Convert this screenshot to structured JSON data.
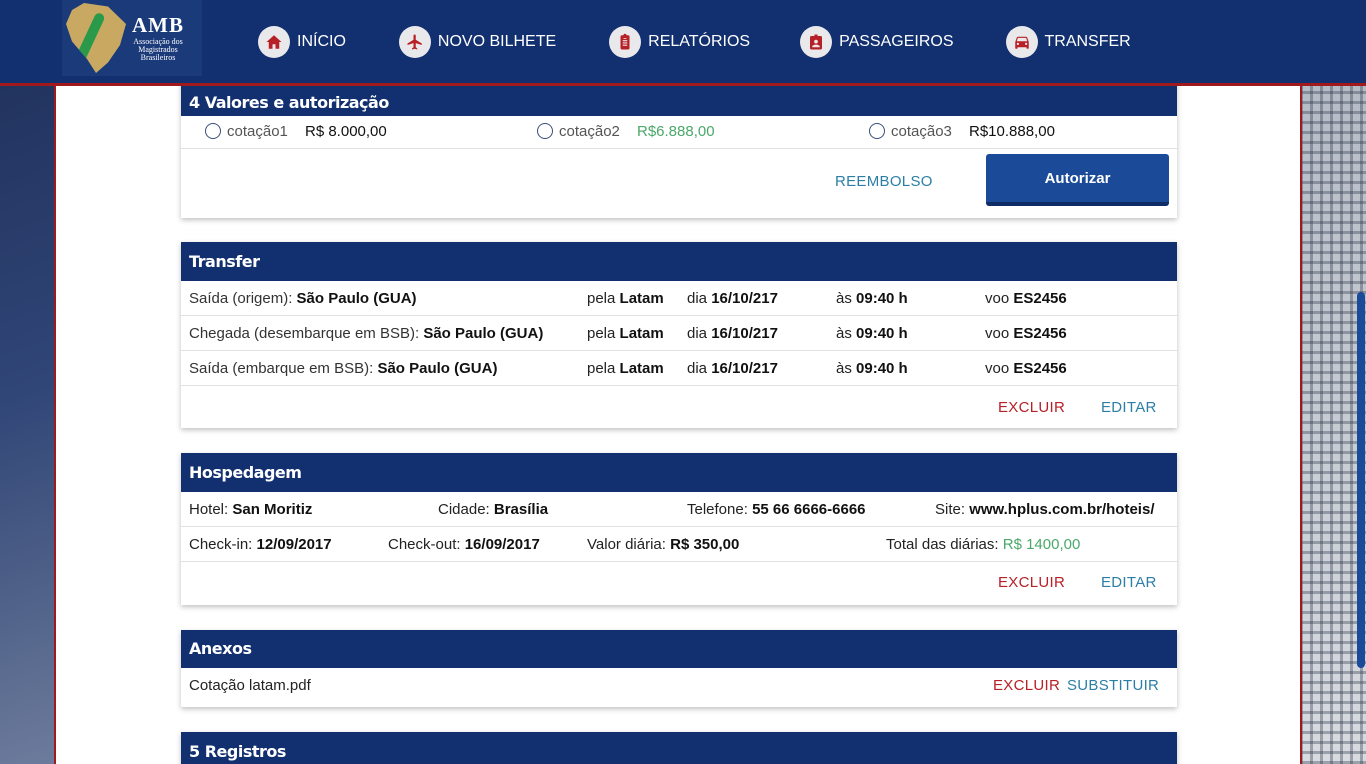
{
  "header": {
    "logo_title": "AMB",
    "logo_sub1": "Associação dos",
    "logo_sub2": "Magistrados",
    "logo_sub3": "Brasileiros",
    "nav": [
      {
        "label": "INÍCIO",
        "icon": "home-icon"
      },
      {
        "label": "NOVO BILHETE",
        "icon": "airplane-icon"
      },
      {
        "label": "RELATÓRIOS",
        "icon": "clipboard-icon"
      },
      {
        "label": "PASSAGEIROS",
        "icon": "badge-icon"
      },
      {
        "label": "TRANSFER",
        "icon": "car-icon"
      }
    ]
  },
  "valores": {
    "title": "4 Valores e autorização",
    "options": [
      {
        "label": "cotação1",
        "value": "R$ 8.000,00"
      },
      {
        "label": "cotação2",
        "value": "R$6.888,00"
      },
      {
        "label": "cotação3",
        "value": "R$10.888,00"
      }
    ],
    "reembolso": "REEMBOLSO",
    "autorizar": "Autorizar"
  },
  "transfer": {
    "title": "Transfer",
    "rows": [
      {
        "label": "Saída (origem):",
        "place": "São Paulo (GUA)",
        "pela": "pela",
        "company": "Latam",
        "dia": "dia",
        "date": "16/10/217",
        "as": "às",
        "time": "09:40 h",
        "voo": "voo",
        "flight": "ES2456"
      },
      {
        "label": "Chegada (desembarque em BSB):",
        "place": "São Paulo (GUA)",
        "pela": "pela",
        "company": "Latam",
        "dia": "dia",
        "date": "16/10/217",
        "as": "às",
        "time": "09:40 h",
        "voo": "voo",
        "flight": "ES2456"
      },
      {
        "label": "Saída (embarque em BSB):",
        "place": "São Paulo (GUA)",
        "pela": "pela",
        "company": "Latam",
        "dia": "dia",
        "date": "16/10/217",
        "as": "às",
        "time": "09:40 h",
        "voo": "voo",
        "flight": "ES2456"
      }
    ],
    "excluir": "EXCLUIR",
    "editar": "EDITAR"
  },
  "hospedagem": {
    "title": "Hospedagem",
    "hotel_label": "Hotel:",
    "hotel": "San Moritiz",
    "cidade_label": "Cidade:",
    "cidade": "Brasília",
    "telefone_label": "Telefone:",
    "telefone": "55 66 6666-6666",
    "site_label": "Site:",
    "site": "www.hplus.com.br/hoteis/",
    "checkin_label": "Check-in:",
    "checkin": "12/09/2017",
    "checkout_label": "Check-out:",
    "checkout": "16/09/2017",
    "diaria_label": "Valor diária:",
    "diaria": "R$ 350,00",
    "total_label": "Total das diárias:",
    "total": "R$ 1400,00",
    "excluir": "EXCLUIR",
    "editar": "EDITAR"
  },
  "anexos": {
    "title": "Anexos",
    "file": "Cotação latam.pdf",
    "excluir": "EXCLUIR",
    "substituir": "SUBSTITUIR"
  },
  "registros": {
    "title": "5 Registros"
  },
  "colors": {
    "header": "#12306f",
    "accent_red": "#b72026",
    "link_teal": "#2b7fa6",
    "price_green": "#4aa86a"
  }
}
